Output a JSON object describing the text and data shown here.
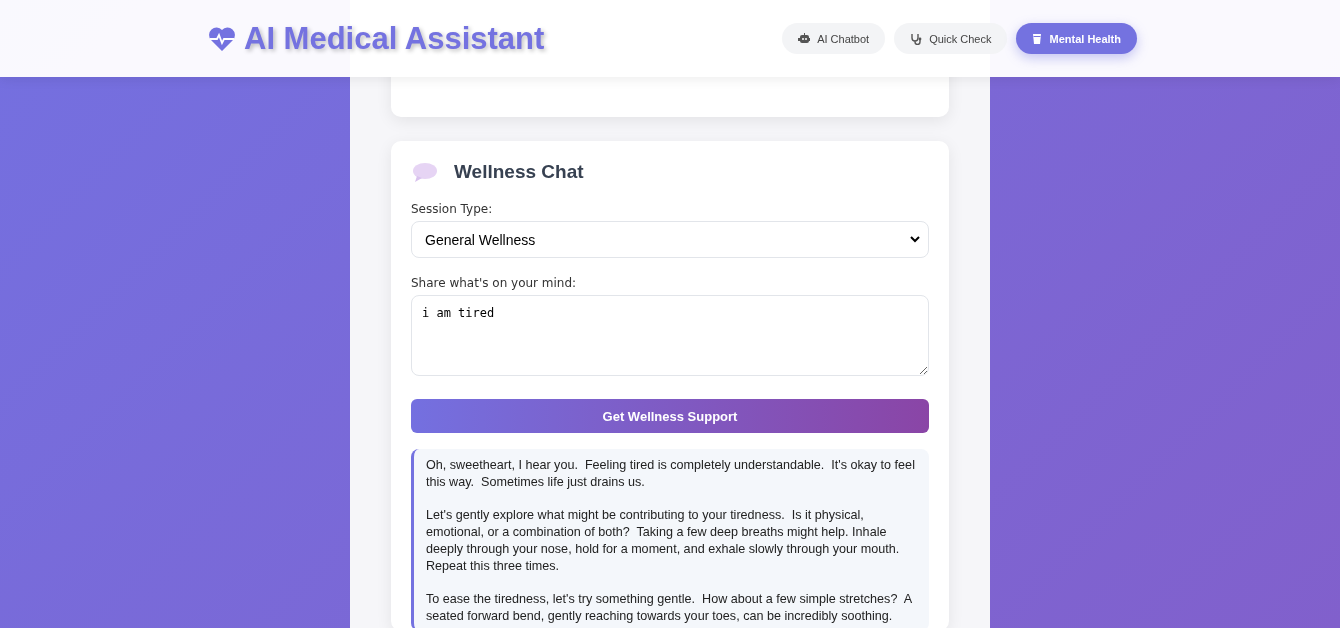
{
  "header": {
    "title": "AI Medical Assistant"
  },
  "nav": [
    {
      "label": "AI Chatbot",
      "kind": "robot",
      "selected": false
    },
    {
      "label": "Quick Check",
      "kind": "stethoscope",
      "selected": false
    },
    {
      "label": "Mental Health",
      "kind": "cup",
      "selected": true
    }
  ],
  "wellness_chat": {
    "title": "Wellness Chat",
    "session_type": {
      "label": "Session Type:",
      "value": "General Wellness"
    },
    "message": {
      "label": "Share what's on your mind:",
      "value": "i am tired"
    },
    "submit": "Get Wellness Support",
    "response": [
      "Oh, sweetheart, I hear you.  Feeling tired is completely understandable.  It's okay to feel this way.  Sometimes life just drains us.",
      "Let's gently explore what might be contributing to your tiredness.  Is it physical, emotional, or a combination of both?  Taking a few deep breaths might help. Inhale deeply through your nose, hold for a moment, and exhale slowly through your mouth. Repeat this three times.",
      "To ease the tiredness, let's try something gentle.  How about a few simple stretches?  A seated forward bend, gently reaching towards your toes, can be incredibly soothing."
    ]
  }
}
